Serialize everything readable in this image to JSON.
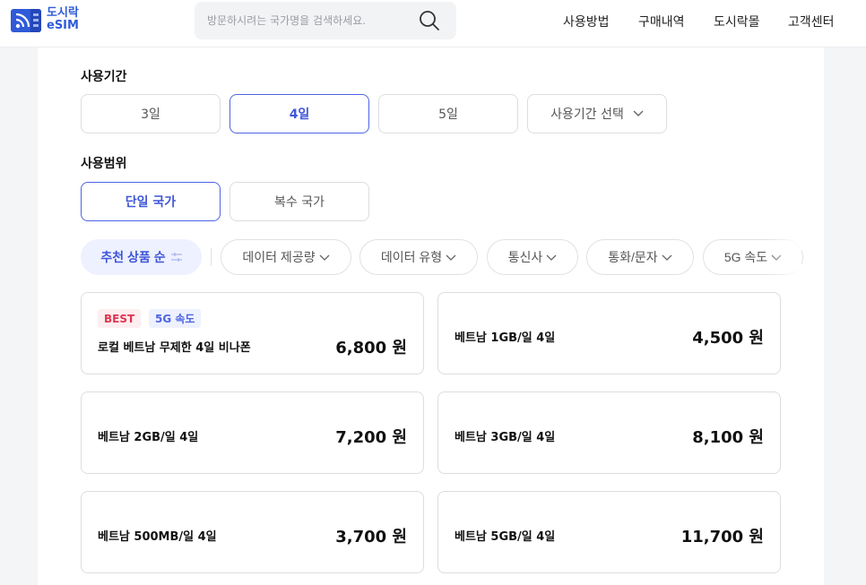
{
  "header": {
    "logo_line1": "도시락",
    "logo_line2": "eSIM",
    "search_placeholder": "방문하시려는 국가명을 검색하세요.",
    "nav": [
      "사용방법",
      "구매내역",
      "도시락몰",
      "고객센터"
    ]
  },
  "period": {
    "label": "사용기간",
    "options": [
      "3일",
      "4일",
      "5일"
    ],
    "select_label": "사용기간 선택",
    "selected": "4일"
  },
  "scope": {
    "label": "사용범위",
    "options": [
      "단일 국가",
      "복수 국가"
    ],
    "selected": "단일 국가"
  },
  "filters": {
    "sort_label": "추천 상품 순",
    "chips": [
      "데이터 제공량",
      "데이터 유형",
      "통신사",
      "통화/문자",
      "5G 속도"
    ]
  },
  "products": [
    {
      "name": "로컬 베트남 무제한 4일 비나폰",
      "price": "6,800 원",
      "badges": [
        "BEST",
        "5G 속도"
      ]
    },
    {
      "name": "베트남 1GB/일 4일",
      "price": "4,500 원"
    },
    {
      "name": "베트남 2GB/일 4일",
      "price": "7,200 원"
    },
    {
      "name": "베트남 3GB/일 4일",
      "price": "8,100 원"
    },
    {
      "name": "베트남 500MB/일 4일",
      "price": "3,700 원"
    },
    {
      "name": "베트남 5GB/일 4일",
      "price": "11,700 원"
    }
  ],
  "colors": {
    "brand": "#2f5bd8",
    "accent": "#4c64e3",
    "best_badge": "#e03451"
  }
}
